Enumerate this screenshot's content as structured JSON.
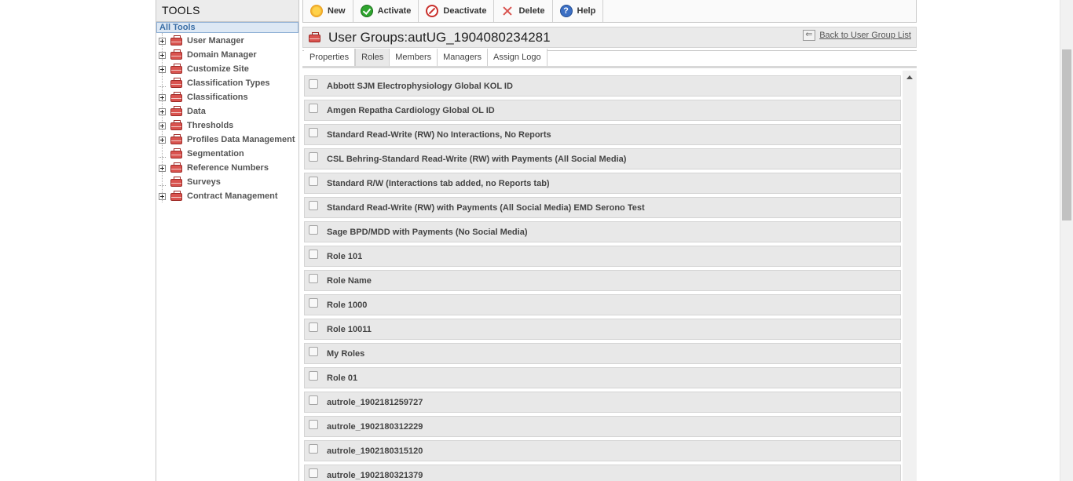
{
  "tools": {
    "header": "TOOLS",
    "all_tools": "All Tools",
    "items": [
      {
        "label": "User Manager",
        "expandable": true
      },
      {
        "label": "Domain Manager",
        "expandable": true
      },
      {
        "label": "Customize Site",
        "expandable": true
      },
      {
        "label": "Classification Types",
        "expandable": false
      },
      {
        "label": "Classifications",
        "expandable": true
      },
      {
        "label": "Data",
        "expandable": true
      },
      {
        "label": "Thresholds",
        "expandable": true
      },
      {
        "label": "Profiles Data Management",
        "expandable": true
      },
      {
        "label": "Segmentation",
        "expandable": false
      },
      {
        "label": "Reference Numbers",
        "expandable": true
      },
      {
        "label": "Surveys",
        "expandable": false
      },
      {
        "label": "Contract Management",
        "expandable": true
      }
    ]
  },
  "toolbar": {
    "new": "New",
    "activate": "Activate",
    "deactivate": "Deactivate",
    "delete": "Delete",
    "help": "Help"
  },
  "title": "User Groups:autUG_1904080234281",
  "back_link": "Back to User Group List",
  "tabs": [
    "Properties",
    "Roles",
    "Members",
    "Managers",
    "Assign Logo"
  ],
  "active_tab": "Roles",
  "roles": [
    "Abbott SJM Electrophysiology Global KOL ID",
    "Amgen Repatha Cardiology Global OL ID",
    "Standard Read-Write (RW) No Interactions, No Reports",
    "CSL Behring-Standard Read-Write (RW) with Payments (All Social Media)",
    "Standard R/W (Interactions tab added, no Reports tab)",
    "Standard Read-Write (RW) with Payments (All Social Media) EMD Serono Test",
    "Sage BPD/MDD with Payments (No Social Media)",
    "Role 101",
    "Role Name",
    "Role 1000",
    "Role 10011",
    "My Roles",
    "Role 01",
    "autrole_1902181259727",
    "autrole_1902180312229",
    "autrole_1902180315120",
    "autrole_1902180321379"
  ],
  "help_glyph": "?"
}
